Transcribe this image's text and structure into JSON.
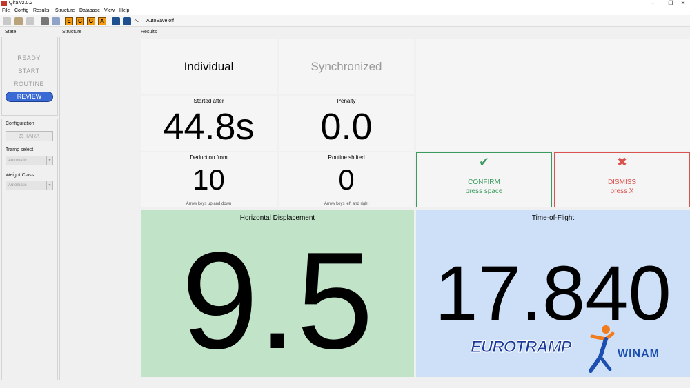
{
  "window": {
    "title": "Qira v2.0.2",
    "minimize": "–",
    "restore": "❐",
    "close": "✕"
  },
  "menu": [
    "File",
    "Config",
    "Results",
    "Structure",
    "Database",
    "View",
    "Help"
  ],
  "toolbar": {
    "letters": [
      "E",
      "C",
      "G",
      "A"
    ],
    "autosave": "AutoSave off"
  },
  "sections": {
    "state": "State",
    "structure": "Structure",
    "results": "Results"
  },
  "state": {
    "items": [
      "READY",
      "START",
      "ROUTINE"
    ],
    "active": "REVIEW"
  },
  "configuration": {
    "title": "Configuration",
    "tara": "TARA",
    "tramp_label": "Tramp select",
    "tramp_value": "Automatic",
    "weight_label": "Weight Class",
    "weight_value": "Automatic"
  },
  "results": {
    "mode_individual": "Individual",
    "mode_synchronized": "Synchronized",
    "started_after_label": "Started after",
    "started_after_value": "44.8s",
    "penalty_label": "Penalty",
    "penalty_value": "0.0",
    "deduction_label": "Deduction from",
    "deduction_value": "10",
    "deduction_hint": "Arrow keys up and down",
    "shifted_label": "Routine shifted",
    "shifted_value": "0",
    "shifted_hint": "Arrow keys left and right"
  },
  "actions": {
    "confirm_line1": "CONFIRM",
    "confirm_line2": "press space",
    "dismiss_line1": "DISMISS",
    "dismiss_line2": "press X"
  },
  "displacement": {
    "label": "Horizontal Displacement",
    "value": "9.5"
  },
  "tof": {
    "label": "Time-of-Flight",
    "value": "17.840"
  },
  "logos": {
    "eurotramp": "EUROTRAMP",
    "winam": "WINAM"
  },
  "colors": {
    "confirm": "#3c9a5f",
    "dismiss": "#d9534f",
    "displacement_bg": "#c1e4c9",
    "tof_bg": "#cde0f7",
    "review": "#3a6ad4"
  }
}
